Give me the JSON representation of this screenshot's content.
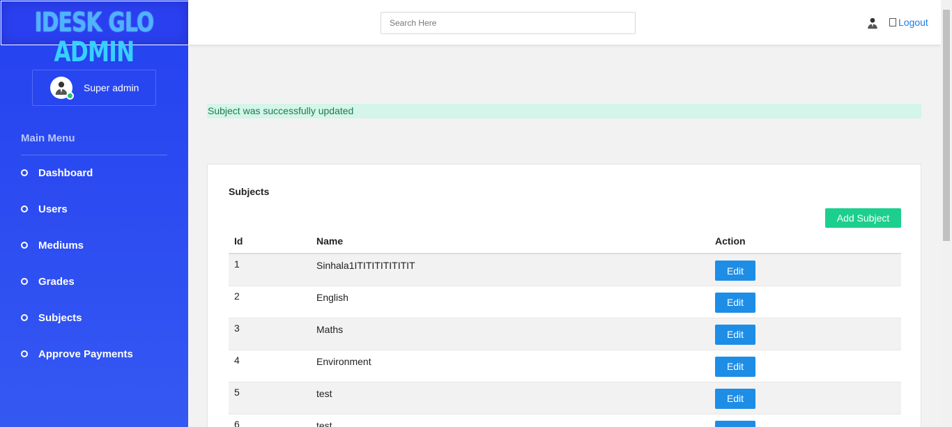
{
  "brand": {
    "line1": "IDESK GLO",
    "line2": "ADMIN"
  },
  "user": {
    "name": "Super admin"
  },
  "menu": {
    "title": "Main Menu",
    "items": [
      {
        "label": "Dashboard"
      },
      {
        "label": "Users"
      },
      {
        "label": "Mediums"
      },
      {
        "label": "Grades"
      },
      {
        "label": "Subjects"
      },
      {
        "label": "Approve Payments"
      }
    ]
  },
  "header": {
    "search_placeholder": "Search Here",
    "logout_label": "Logout"
  },
  "alert": {
    "message": "Subject was successfully updated"
  },
  "subjects": {
    "title": "Subjects",
    "add_label": "Add Subject",
    "columns": [
      "Id",
      "Name",
      "Action"
    ],
    "edit_label": "Edit",
    "rows": [
      {
        "id": "1",
        "name": "Sinhala1ITITITITITITIT"
      },
      {
        "id": "2",
        "name": "English"
      },
      {
        "id": "3",
        "name": "Maths"
      },
      {
        "id": "4",
        "name": "Environment"
      },
      {
        "id": "5",
        "name": "test"
      },
      {
        "id": "6",
        "name": "test"
      }
    ]
  },
  "colors": {
    "sidebar": "#2441f0",
    "accent_green": "#1ccf8d",
    "edit_blue": "#1e8de6",
    "alert_bg": "#d4f5e9"
  }
}
